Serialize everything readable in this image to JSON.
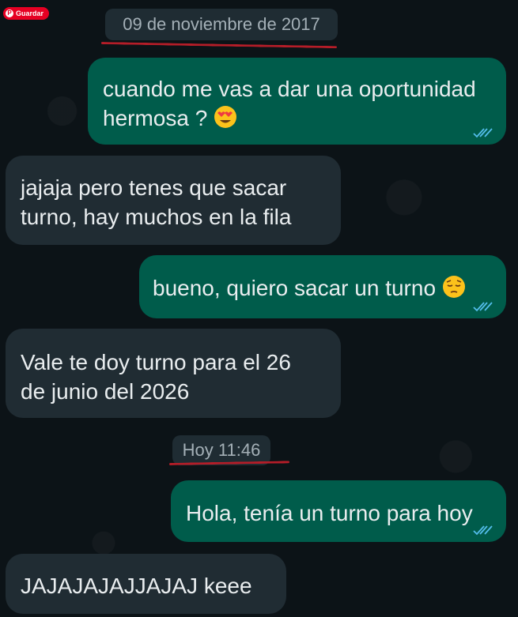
{
  "save_button": {
    "label": "Guardar"
  },
  "dates": {
    "first": "09 de noviembre de 2017",
    "second": "Hoy 11:46"
  },
  "messages": [
    {
      "direction": "outgoing",
      "lines": [
        "cuando me vas a dar una oportunidad",
        "hermosa ?"
      ],
      "emoji": "heart-eyes-emoji",
      "status": "read"
    },
    {
      "direction": "incoming",
      "lines": [
        "jajaja pero tenes que sacar",
        "turno, hay muchos en la fila"
      ]
    },
    {
      "direction": "outgoing",
      "lines": [
        "bueno, quiero sacar un turno"
      ],
      "emoji": "pensive-emoji",
      "status": "read"
    },
    {
      "direction": "incoming",
      "lines": [
        "Vale te doy turno para el 26",
        "de junio del 2026"
      ]
    },
    {
      "direction": "outgoing",
      "lines": [
        "Hola, tenía un turno para hoy"
      ],
      "status": "read"
    },
    {
      "direction": "incoming",
      "lines": [
        "JAJAJAJAJJAJAJ keee"
      ]
    }
  ],
  "colors": {
    "outgoing_bubble": "#005c4b",
    "incoming_bubble": "#202c33",
    "read_ticks": "#53bdeb",
    "annotation_underline": "#b51d28",
    "pinterest_red": "#e60023"
  }
}
